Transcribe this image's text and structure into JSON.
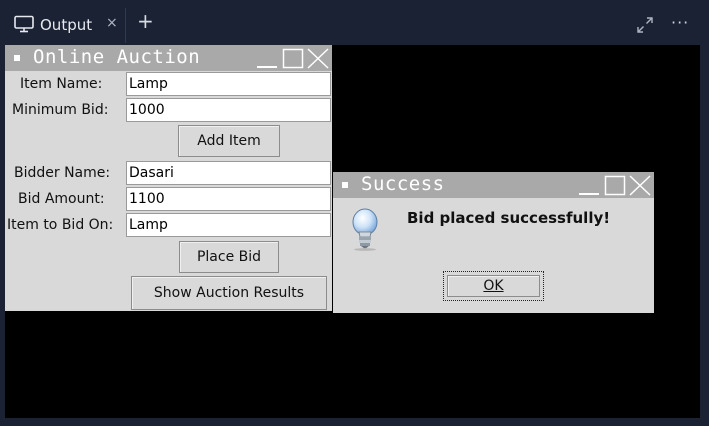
{
  "panel": {
    "tab_label": "Output",
    "tab_close": "×",
    "new_tab": "+",
    "more": "···",
    "colors": {
      "background": "#1b2233",
      "terminal": "#000000",
      "tab_text": "#e6e9ef"
    }
  },
  "auction_window": {
    "title": "Online Auction",
    "fields": {
      "item_name": {
        "label": "Item Name:",
        "value": "Lamp"
      },
      "minimum_bid": {
        "label": "Minimum Bid:",
        "value": "1000"
      },
      "bidder_name": {
        "label": "Bidder Name:",
        "value": "Dasari"
      },
      "bid_amount": {
        "label": "Bid Amount:",
        "value": "1100"
      },
      "item_to_bid_on": {
        "label": "Item to Bid On:",
        "value": "Lamp"
      }
    },
    "buttons": {
      "add_item": "Add Item",
      "place_bid": "Place Bid",
      "show_results": "Show Auction Results"
    },
    "colors": {
      "window": "#d9d9d9",
      "titlebar": "#a9a9a9"
    }
  },
  "success_dialog": {
    "title": "Success",
    "message": "Bid placed successfully!",
    "ok_label": "OK",
    "icon": "lightbulb-info-icon"
  }
}
